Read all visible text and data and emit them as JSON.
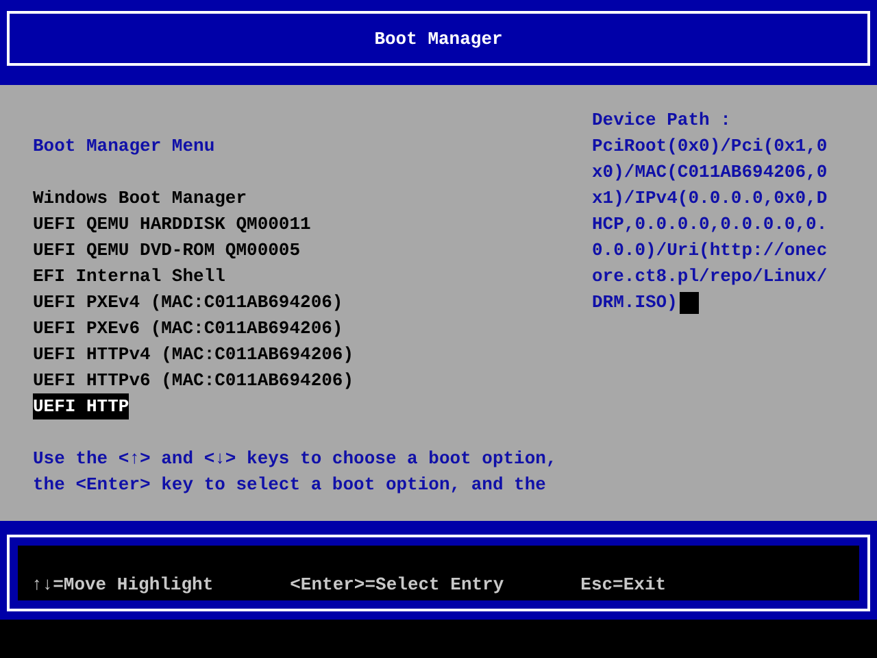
{
  "header": {
    "title": "Boot Manager"
  },
  "menu": {
    "title": "Boot Manager Menu",
    "items": [
      {
        "label": "Windows Boot Manager",
        "selected": false
      },
      {
        "label": "UEFI QEMU HARDDISK QM00011",
        "selected": false
      },
      {
        "label": "UEFI QEMU DVD-ROM QM00005",
        "selected": false
      },
      {
        "label": "EFI Internal Shell",
        "selected": false
      },
      {
        "label": "UEFI PXEv4 (MAC:C011AB694206)",
        "selected": false
      },
      {
        "label": "UEFI PXEv6 (MAC:C011AB694206)",
        "selected": false
      },
      {
        "label": "UEFI HTTPv4 (MAC:C011AB694206)",
        "selected": false
      },
      {
        "label": "UEFI HTTPv6 (MAC:C011AB694206)",
        "selected": false
      },
      {
        "label": "UEFI HTTP",
        "selected": true
      }
    ],
    "help": [
      "Use the <↑> and <↓> keys to choose a boot option,",
      "the <Enter> key to select a boot option, and the"
    ]
  },
  "device_path": {
    "label": "Device Path :",
    "lines": [
      "PciRoot(0x0)/Pci(0x1,0",
      "x0)/MAC(C011AB694206,0",
      "x1)/IPv4(0.0.0.0,0x0,D",
      "HCP,0.0.0.0,0.0.0.0,0.",
      "0.0.0)/Uri(http://onec",
      "ore.ct8.pl/repo/Linux/",
      "DRM.ISO)"
    ]
  },
  "footer": {
    "hints": [
      "↑↓=Move Highlight",
      "<Enter>=Select Entry",
      "Esc=Exit"
    ]
  }
}
